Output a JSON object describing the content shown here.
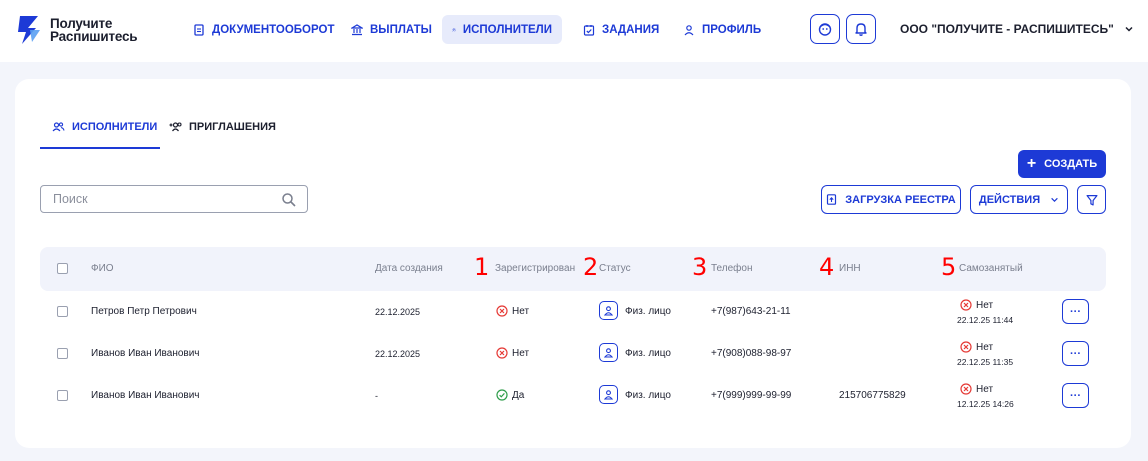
{
  "brand": {
    "line1": "Получите",
    "line2": "Распишитесь"
  },
  "nav": [
    {
      "label": "ДОКУМЕНТООБОРОТ",
      "icon": "document-icon"
    },
    {
      "label": "ВЫПЛАТЫ",
      "icon": "bank-icon"
    },
    {
      "label": "ИСПОЛНИТЕЛИ",
      "icon": "users-icon",
      "active": true
    },
    {
      "label": "ЗАДАНИЯ",
      "icon": "calendar-check-icon"
    },
    {
      "label": "ПРОФИЛЬ",
      "icon": "user-icon"
    }
  ],
  "org_name": "ООО \"ПОЛУЧИТЕ - РАСПИШИТЕСЬ\"",
  "tabs": {
    "performers": "ИСПОЛНИТЕЛИ",
    "invitations": "ПРИГЛАШЕНИЯ"
  },
  "toolbar": {
    "create": "СОЗДАТЬ",
    "upload_registry": "ЗАГРУЗКА РЕЕСТРА",
    "actions": "ДЕЙСТВИЯ",
    "search_placeholder": "Поиск"
  },
  "table": {
    "columns": {
      "fio": "ФИО",
      "created": "Дата создания",
      "registered": "Зарегистрирован",
      "status": "Статус",
      "phone": "Телефон",
      "inn": "ИНН",
      "selfemployed": "Самозанятый"
    },
    "markers": [
      "1",
      "2",
      "3",
      "4",
      "5"
    ],
    "rows": [
      {
        "fio": "Петров Петр Петрович",
        "created": "22.12.2025",
        "registered": "Нет",
        "registered_ok": false,
        "status": "Физ. лицо",
        "phone": "+7(987)643-21-11",
        "inn": "",
        "self_status": "Нет",
        "self_date": "22.12.25 11:44",
        "action": "···"
      },
      {
        "fio": "Иванов Иван Иванович",
        "created": "22.12.2025",
        "registered": "Нет",
        "registered_ok": false,
        "status": "Физ. лицо",
        "phone": "+7(908)088-98-97",
        "inn": "",
        "self_status": "Нет",
        "self_date": "22.12.25 11:35",
        "action": "···"
      },
      {
        "fio": "Иванов Иван Иванович",
        "created": "-",
        "registered": "Да",
        "registered_ok": true,
        "status": "Физ. лицо",
        "phone": "+7(999)999-99-99",
        "inn": "215706775829",
        "self_status": "Нет",
        "self_date": "12.12.25 14:26",
        "action": "···"
      }
    ]
  },
  "colors": {
    "accent": "#1d3ad6",
    "error": "#e53935",
    "success": "#2e9d4a",
    "marker": "#ff0000"
  }
}
